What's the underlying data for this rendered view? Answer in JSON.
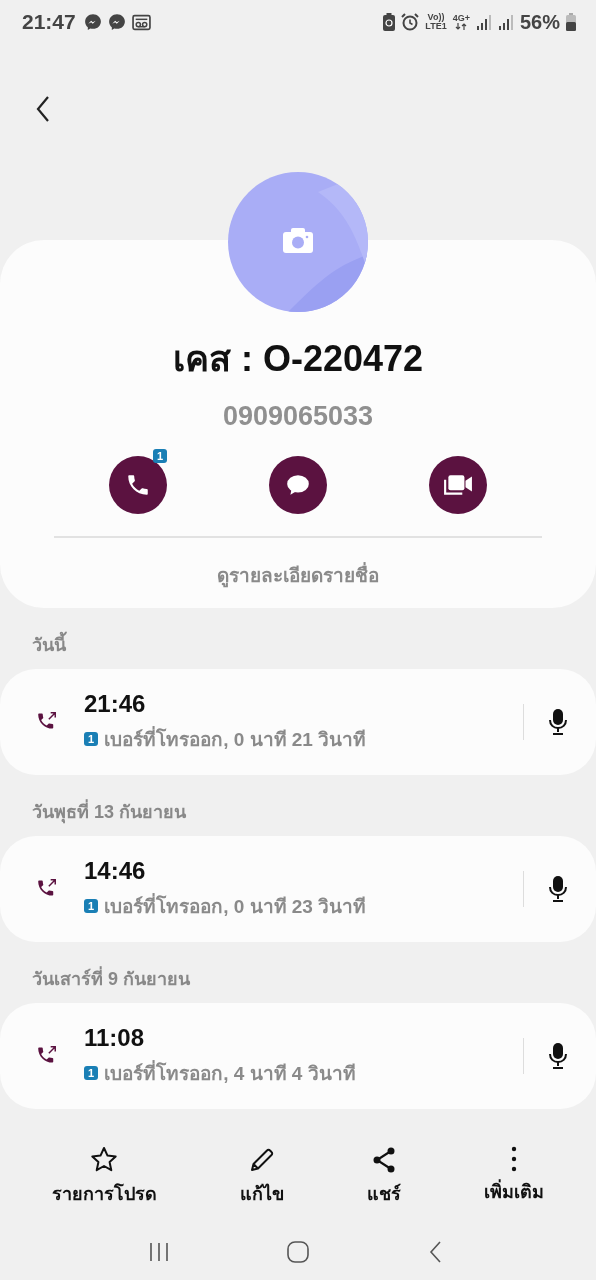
{
  "status_bar": {
    "time": "21:47",
    "network_labels": [
      "Vo))",
      "LTE1",
      "4G+"
    ],
    "battery": "56%"
  },
  "contact": {
    "name": "เคส : O-220472",
    "number": "0909065033",
    "call_badge": "1"
  },
  "details_link": "ดูรายละเอียดรายชื่อ",
  "call_groups": [
    {
      "date": "วันนี้",
      "calls": [
        {
          "kind": "outgoing",
          "time": "21:46",
          "sim": "1",
          "description": "เบอร์ที่โทรออก, 0 นาที 21 วินาที"
        }
      ]
    },
    {
      "date": "วันพุธที่ 13 กันยายน",
      "calls": [
        {
          "kind": "outgoing",
          "time": "14:46",
          "sim": "1",
          "description": "เบอร์ที่โทรออก, 0 นาที 23 วินาที"
        }
      ]
    },
    {
      "date": "วันเสาร์ที่ 9 กันยายน",
      "calls": [
        {
          "kind": "outgoing",
          "time": "11:08",
          "sim": "1",
          "description": "เบอร์ที่โทรออก, 4 นาที 4 วินาที"
        }
      ]
    }
  ],
  "toolbar": [
    {
      "kind": "star",
      "label": "รายการโปรด"
    },
    {
      "kind": "edit",
      "label": "แก้ไข"
    },
    {
      "kind": "share",
      "label": "แชร์"
    },
    {
      "kind": "more",
      "label": "เพิ่มเติม"
    }
  ]
}
